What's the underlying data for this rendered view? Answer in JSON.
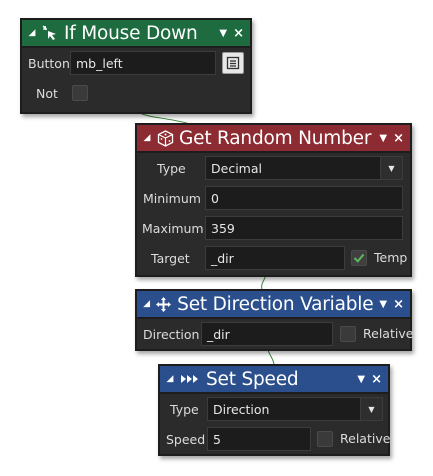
{
  "blocks": {
    "mouse_down": {
      "title": "If Mouse Down",
      "button_label": "Button",
      "button_value": "mb_left",
      "not_label": "Not",
      "not_checked": false
    },
    "random": {
      "title": "Get Random Number",
      "type_label": "Type",
      "type_value": "Decimal",
      "minimum_label": "Minimum",
      "minimum_value": "0",
      "maximum_label": "Maximum",
      "maximum_value": "359",
      "target_label": "Target",
      "target_value": "_dir",
      "temp_label": "Temp",
      "temp_checked": true
    },
    "direction": {
      "title": "Set Direction Variable",
      "direction_label": "Direction",
      "direction_value": "_dir",
      "relative_label": "Relative",
      "relative_checked": false
    },
    "speed": {
      "title": "Set Speed",
      "type_label": "Type",
      "type_value": "Direction",
      "speed_label": "Speed",
      "speed_value": "5",
      "relative_label": "Relative",
      "relative_checked": false
    }
  },
  "colors": {
    "green_header": "#1d6b3f",
    "red_header": "#8c2b31",
    "blue_header": "#2b4f8c",
    "panel": "#2b2b2b",
    "check": "#5cb85c"
  },
  "icons": [
    "mouse-click-icon",
    "dice-icon",
    "move-arrows-icon",
    "fast-forward-icon",
    "menu-arrow-icon",
    "close-icon",
    "collapse-triangle-icon",
    "picker-icon",
    "checkmark-icon"
  ]
}
